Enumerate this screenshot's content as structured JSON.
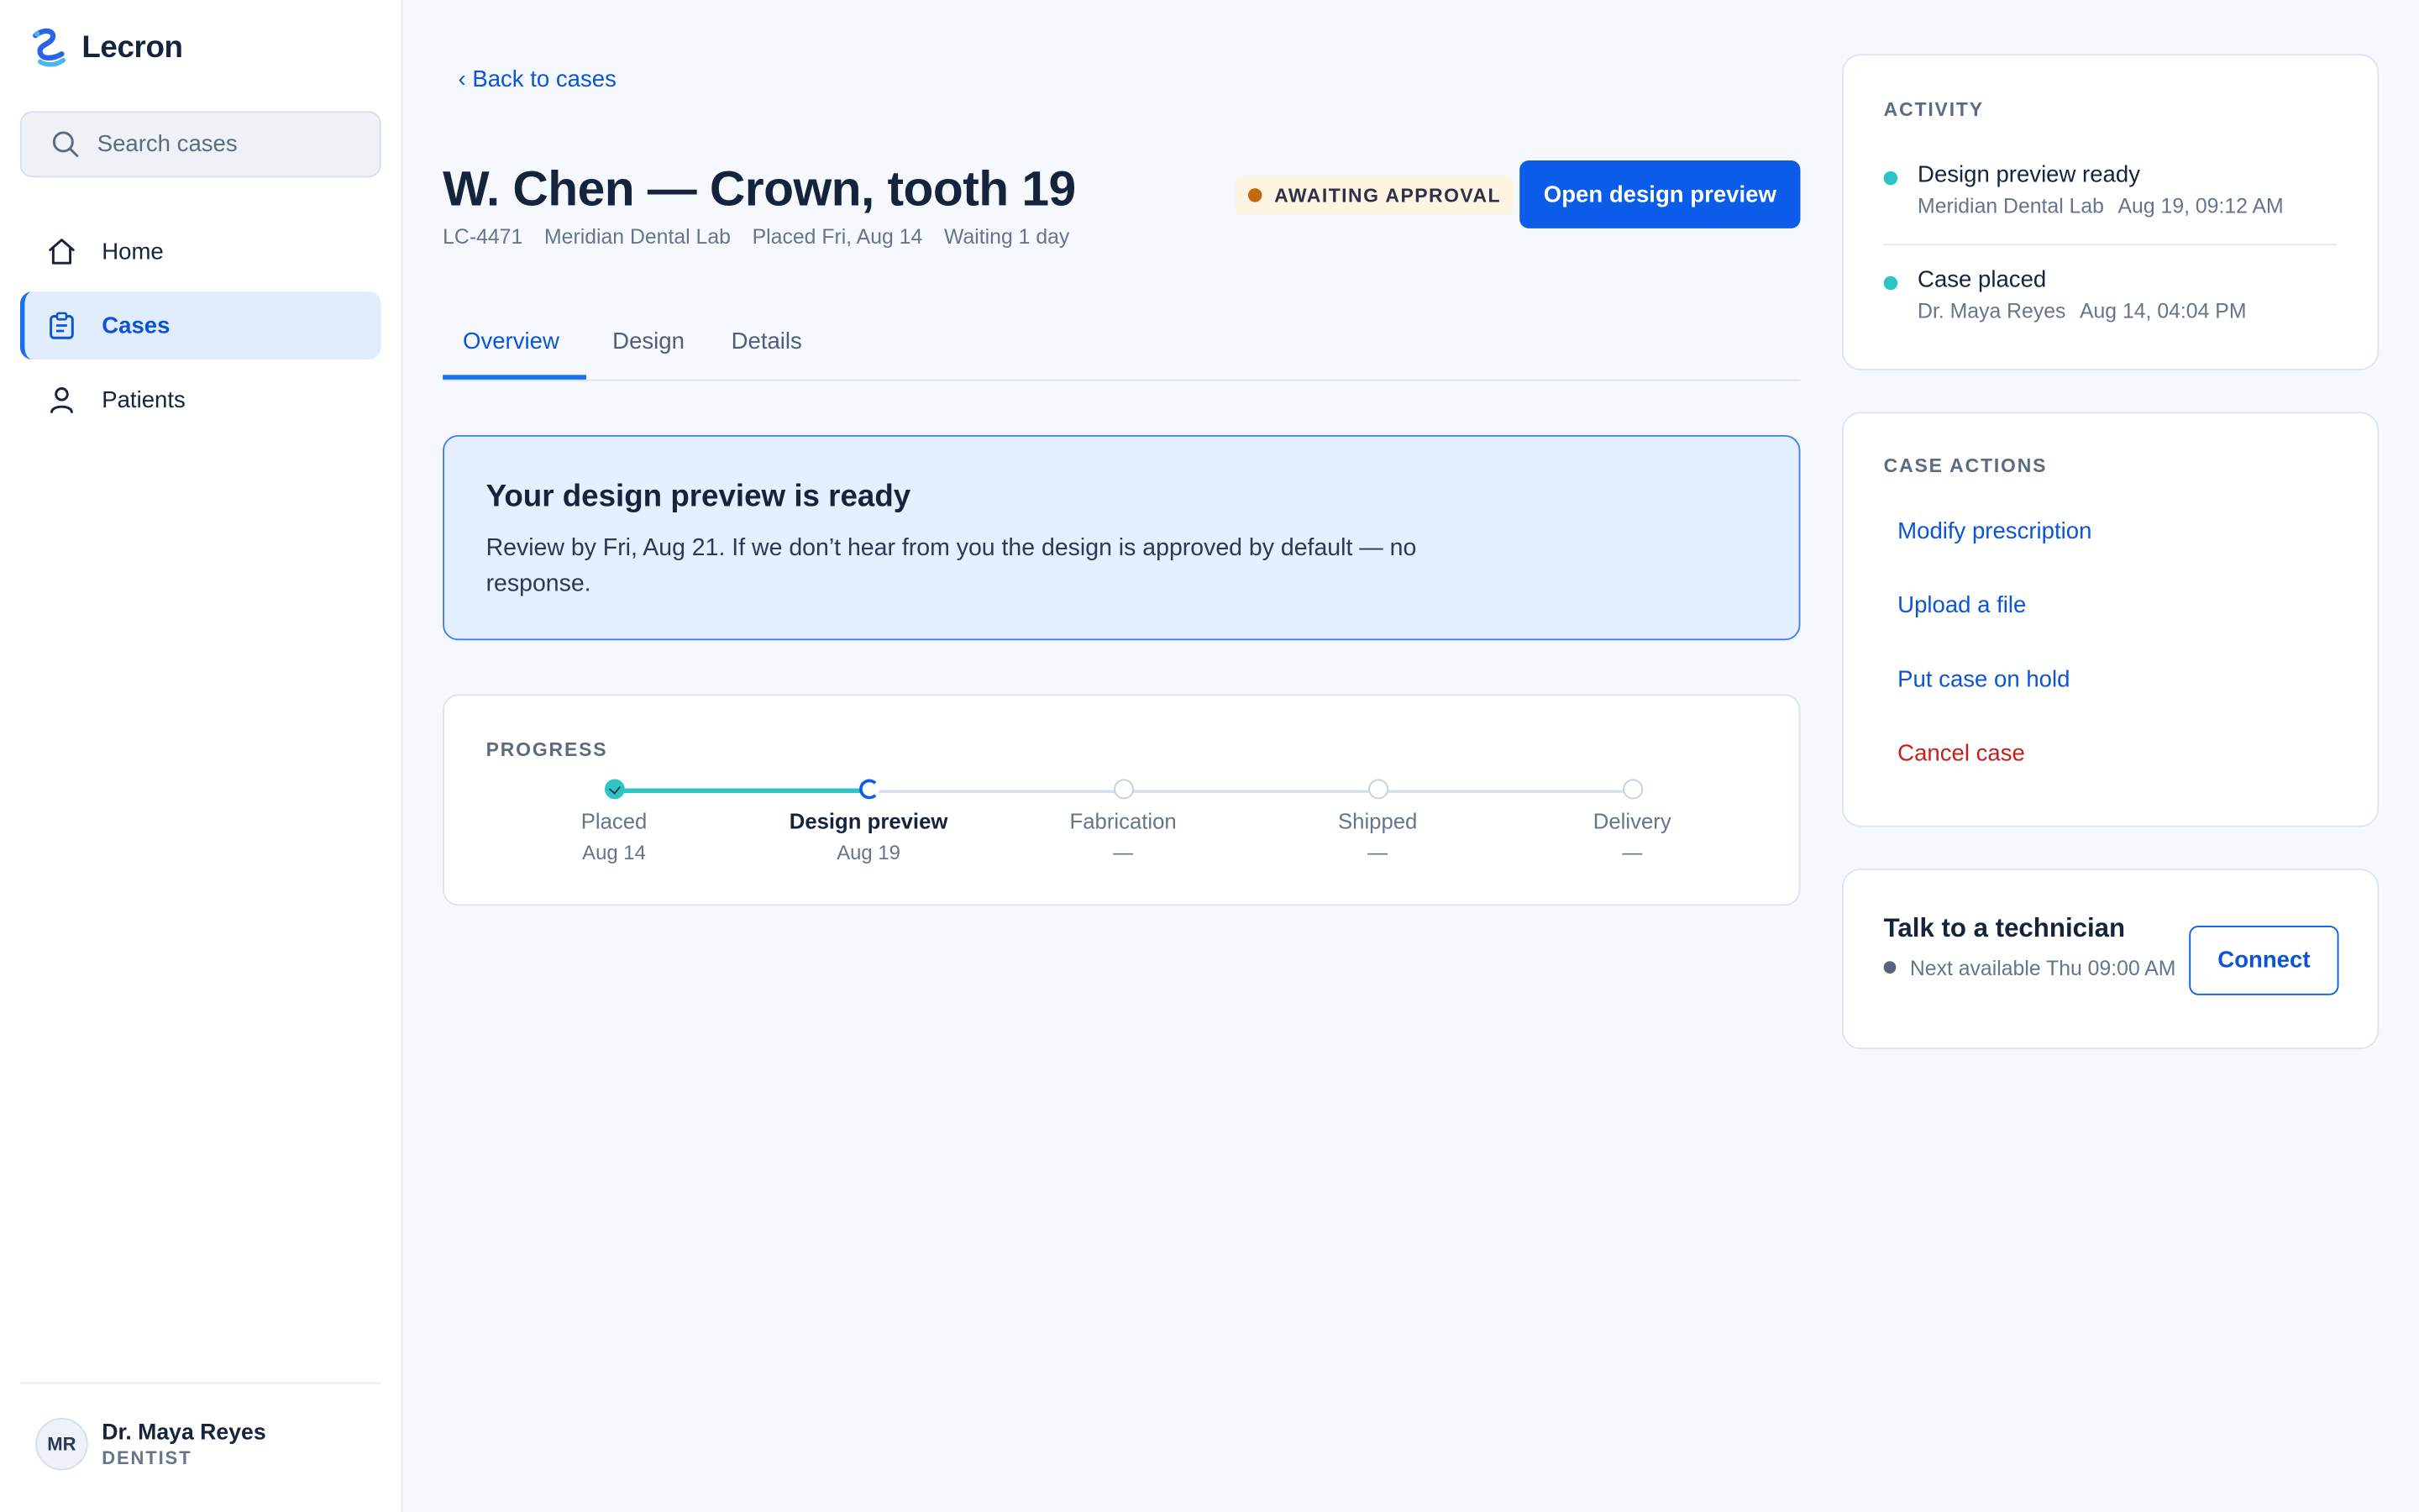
{
  "app": {
    "name": "Lecron"
  },
  "sidebar": {
    "search": {
      "placeholder": "Search cases",
      "value": ""
    },
    "items": [
      {
        "label": "Home",
        "icon": "home-icon",
        "active": false
      },
      {
        "label": "Cases",
        "icon": "clipboard-icon",
        "active": true
      },
      {
        "label": "Patients",
        "icon": "user-icon",
        "active": false
      }
    ],
    "user": {
      "initials": "MR",
      "name": "Dr. Maya Reyes",
      "role": "DENTIST"
    }
  },
  "header": {
    "back_label": "‹ Back to cases",
    "title": "W. Chen — Crown, tooth 19",
    "meta": [
      "LC-4471",
      "Meridian Dental Lab",
      "Placed Fri, Aug 14",
      "Waiting 1 day"
    ],
    "status": {
      "label": "AWAITING APPROVAL",
      "color": "#c26a10"
    },
    "primary_button": "Open design preview"
  },
  "tabs": [
    {
      "label": "Overview",
      "active": true
    },
    {
      "label": "Design",
      "active": false
    },
    {
      "label": "Details",
      "active": false
    }
  ],
  "callout": {
    "title": "Your design preview is ready",
    "body": "Review by Fri, Aug 21. If we don’t hear from you the design is approved by default — no response."
  },
  "progress": {
    "label": "PROGRESS",
    "steps": [
      {
        "name": "Placed",
        "date": "Aug 14",
        "state": "done"
      },
      {
        "name": "Design preview",
        "date": "Aug 19",
        "state": "current"
      },
      {
        "name": "Fabrication",
        "date": "—",
        "state": "pending"
      },
      {
        "name": "Shipped",
        "date": "—",
        "state": "pending"
      },
      {
        "name": "Delivery",
        "date": "—",
        "state": "pending"
      }
    ]
  },
  "activity": {
    "label": "ACTIVITY",
    "items": [
      {
        "title": "Design preview ready",
        "actor": "Meridian Dental Lab",
        "time": "Aug 19, 09:12 AM"
      },
      {
        "title": "Case placed",
        "actor": "Dr. Maya Reyes",
        "time": "Aug 14, 04:04 PM"
      }
    ]
  },
  "case_actions": {
    "label": "CASE ACTIONS",
    "items": [
      {
        "label": "Modify prescription",
        "danger": false
      },
      {
        "label": "Upload a file",
        "danger": false
      },
      {
        "label": "Put case on hold",
        "danger": false
      },
      {
        "label": "Cancel case",
        "danger": true
      }
    ]
  },
  "technician": {
    "title": "Talk to a technician",
    "availability": "Next available Thu 09:00 AM",
    "button": "Connect"
  },
  "colors": {
    "accent": "#0b5ce8",
    "teal": "#2ec4c4",
    "danger": "#c81d1d",
    "warning": "#c26a10"
  }
}
